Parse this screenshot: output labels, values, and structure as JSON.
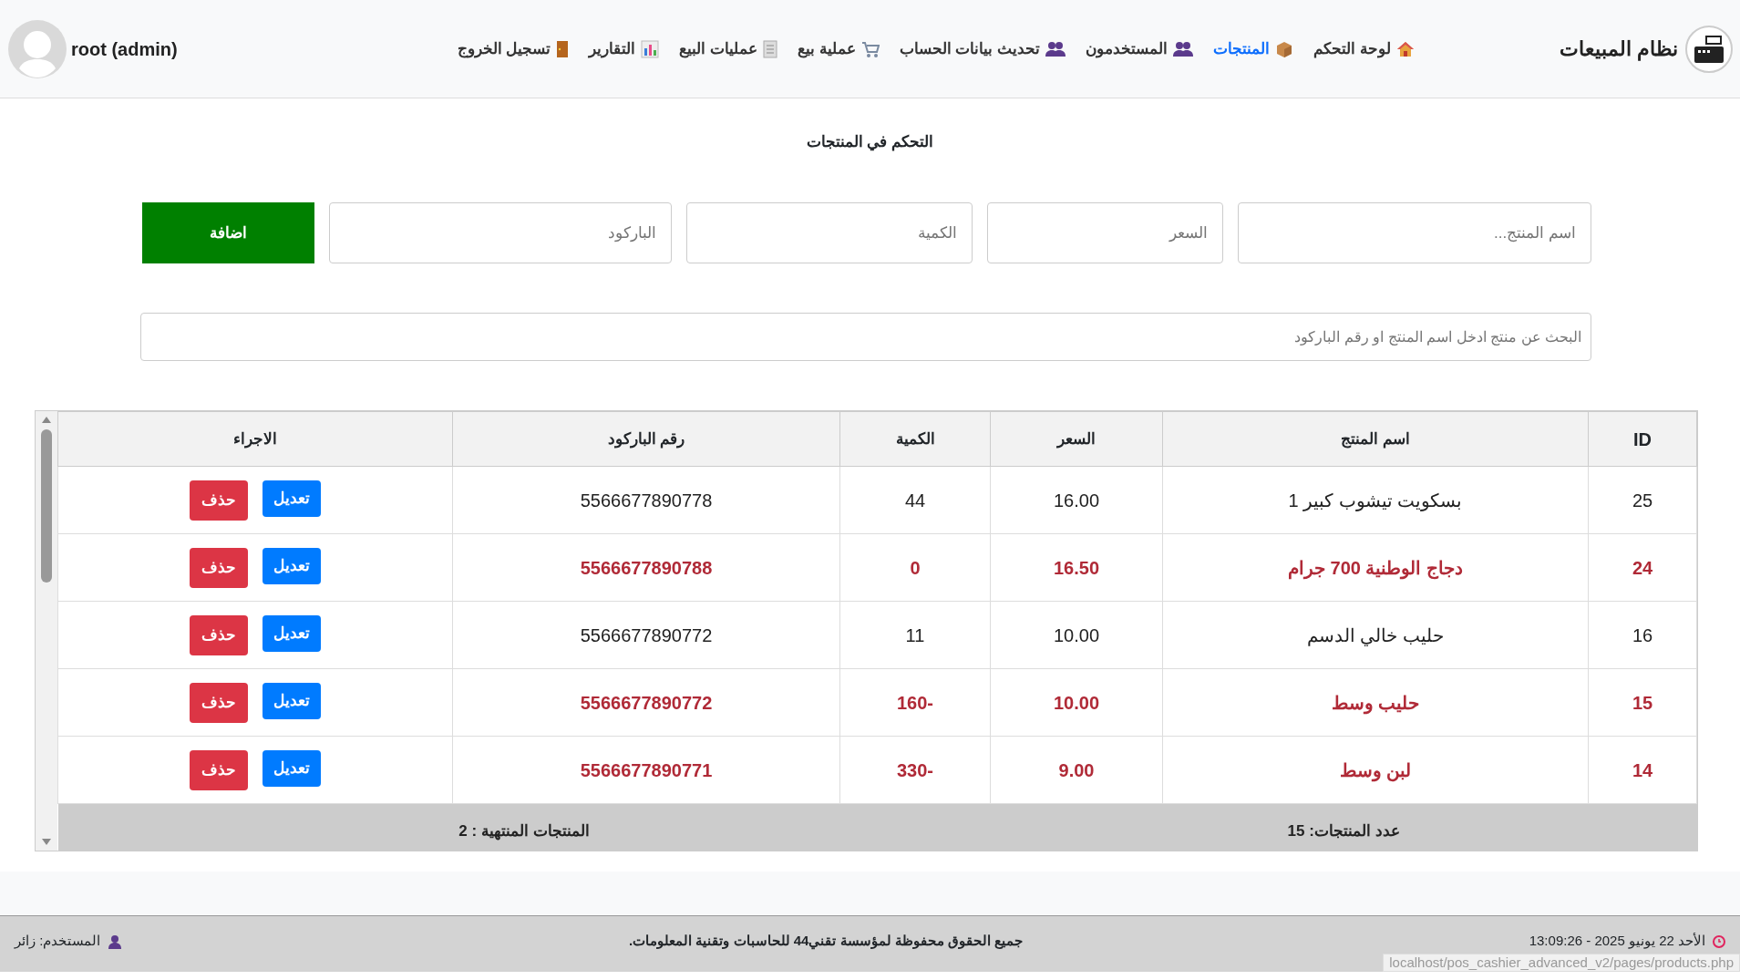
{
  "navbar": {
    "brand": "نظام المبيعات",
    "items": [
      {
        "label": "لوحة التحكم",
        "selected": false
      },
      {
        "label": "المنتجات",
        "selected": true
      },
      {
        "label": "المستخدمون",
        "selected": false
      },
      {
        "label": "تحديث بيانات الحساب",
        "selected": false
      },
      {
        "label": "عملية بيع",
        "selected": false
      },
      {
        "label": "عمليات البيع",
        "selected": false
      },
      {
        "label": "التقارير",
        "selected": false
      },
      {
        "label": "تسجيل الخروج",
        "selected": false
      }
    ],
    "user": "root (admin)"
  },
  "page_title": "التحكم في المنتجات",
  "form": {
    "fields": [
      {
        "placeholder": "اسم المنتج..."
      },
      {
        "placeholder": "السعر"
      },
      {
        "placeholder": "الكمية"
      },
      {
        "placeholder": "الباركود"
      }
    ],
    "add_button": "اضافة"
  },
  "search": {
    "placeholder": "البحث عن منتج ادخل اسم المنتج او رقم الباركود"
  },
  "table": {
    "columns": [
      "ID",
      "اسم المنتج",
      "السعر",
      "الكمية",
      "رقم الباركود",
      "الاجراء"
    ],
    "rows": [
      {
        "cells": [
          "25",
          "بسكويت تيشوب كبير 1",
          "16.00",
          "44",
          "5566677890778"
        ],
        "out_of_stock": false,
        "edit": "تعديل",
        "delete": "حذف"
      },
      {
        "cells": [
          "24",
          "دجاج الوطنية 700 جرام",
          "16.50",
          "0",
          "5566677890788"
        ],
        "out_of_stock": true,
        "edit": "تعديل",
        "delete": "حذف"
      },
      {
        "cells": [
          "16",
          "حليب خالي الدسم",
          "10.00",
          "11",
          "5566677890772"
        ],
        "out_of_stock": false,
        "edit": "تعديل",
        "delete": "حذف"
      },
      {
        "cells": [
          "15",
          "حليب وسط",
          "10.00",
          "160-",
          "5566677890772"
        ],
        "out_of_stock": true,
        "edit": "تعديل",
        "delete": "حذف"
      },
      {
        "cells": [
          "14",
          "لبن وسط",
          "9.00",
          "330-",
          "5566677890771"
        ],
        "out_of_stock": true,
        "edit": "تعديل",
        "delete": "حذف"
      }
    ],
    "summary": {
      "count": "عدد المنتجات: 15",
      "out_count": "المنتجات المنتهية : 2"
    }
  },
  "footer": {
    "datetime": "الأحد 22 يونيو 2025 - 13:09:26",
    "copyright": "جميع الحقوق محفوظة لمؤسسة تقني44 للحاسبات وتقنية المعلومات.",
    "user": "المستخدم: زائر"
  },
  "status_url": "localhost/pos_cashier_advanced_v2/pages/products.php"
}
